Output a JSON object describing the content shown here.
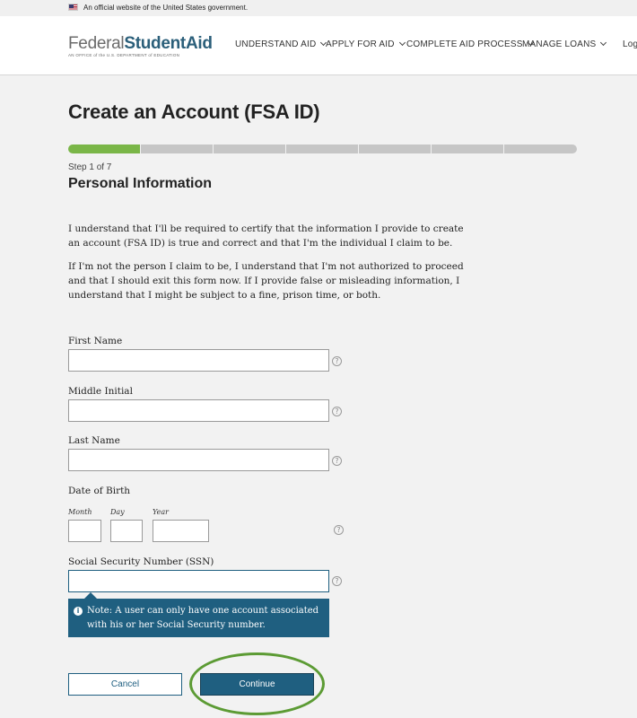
{
  "gov_banner": {
    "flag_icon": "us-flag-icon",
    "text": "An official website of the United States government."
  },
  "header": {
    "logo": {
      "brand_left": "Federal",
      "brand_mid": "Student",
      "brand_right": "Aid",
      "subtitle": "AN OFFICE of the U.S. DEPARTMENT of EDUCATION"
    },
    "nav": [
      {
        "label": "UNDERSTAND AID",
        "icon": "chevron-down-icon"
      },
      {
        "label": "APPLY FOR AID",
        "icon": "chevron-down-icon"
      },
      {
        "label": "COMPLETE AID PROCESS",
        "icon": "chevron-down-icon"
      },
      {
        "label": "MANAGE LOANS",
        "icon": "chevron-down-icon"
      },
      {
        "label": "Log"
      }
    ]
  },
  "page": {
    "title": "Create an Account (FSA ID)",
    "progress": {
      "current_step": 1,
      "total_steps": 7,
      "done_color": "#7ab648",
      "todo_color": "#c6c6c6"
    },
    "step_label": "Step 1 of 7",
    "section_title": "Personal Information",
    "paragraphs": [
      "I understand that I'll be required to certify that the information I provide to create an account (FSA ID) is true and correct and that I'm the individual I claim to be.",
      "If I'm not the person I claim to be, I understand that I'm not authorized to proceed and that I should exit this form now. If I provide false or misleading information, I understand that I might be subject to a fine, prison time, or both."
    ]
  },
  "form": {
    "first_name": {
      "label": "First Name",
      "value": ""
    },
    "middle_initial": {
      "label": "Middle Initial",
      "value": ""
    },
    "last_name": {
      "label": "Last Name",
      "value": ""
    },
    "dob": {
      "label": "Date of Birth",
      "month_label": "Month",
      "day_label": "Day",
      "year_label": "Year",
      "month": "",
      "day": "",
      "year": ""
    },
    "ssn": {
      "label": "Social Security Number (SSN)",
      "value": ""
    },
    "help_glyph": "?",
    "note": {
      "icon": "info-icon",
      "glyph": "i",
      "text": "Note: A user can only have one account associated with his or her Social Security number."
    }
  },
  "actions": {
    "cancel": "Cancel",
    "continue": "Continue"
  },
  "colors": {
    "brand_blue": "#1f5f80",
    "highlight": "#5c9b34"
  }
}
